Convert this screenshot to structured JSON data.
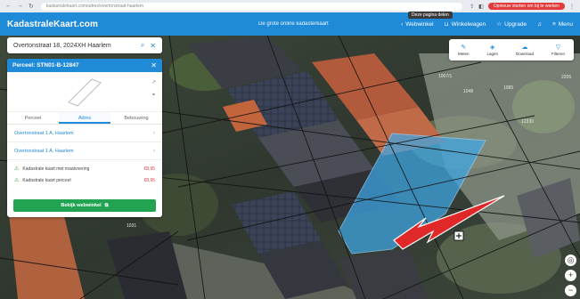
{
  "browser": {
    "url": "kadastralekaart.com/adres/overtonstraat-haarlem",
    "tooltip": "Deze pagina delen",
    "update": "Opnieuw starten om bij te werken"
  },
  "header": {
    "logo": "KadastraleKaart.com",
    "tagline": "De grote online kadasterkaart",
    "actions": [
      {
        "label": "Webwinkel",
        "icon": "cart-icon"
      },
      {
        "label": "Winkelwagen",
        "icon": "basket-icon"
      },
      {
        "label": "Upgrade",
        "icon": "star-icon"
      },
      {
        "label": "Menu",
        "icon": "menu-icon"
      }
    ]
  },
  "search": {
    "value": "Overtonstraat 18, 2024XH Haarlem"
  },
  "panel": {
    "title": "Perceel: STN01-B-12847",
    "tabs": [
      "Perceel",
      "Adres",
      "Bebouwing"
    ],
    "active_tab": 1,
    "addresses": [
      "Overtonstraat 1 A, Haarlem",
      "Overtonstraat 1 A, Haarlem"
    ],
    "products": [
      {
        "label": "Kadastrale kaart met maatvoering",
        "price": "€8,95"
      },
      {
        "label": "Kadastrale kaart perceel",
        "price": "€8,95"
      }
    ],
    "cta": "Bekijk webwinkel"
  },
  "tools": [
    {
      "label": "Meten",
      "icon": "ruler-icon"
    },
    {
      "label": "Lagen",
      "icon": "layers-icon"
    },
    {
      "label": "Download",
      "icon": "cloud-icon"
    },
    {
      "label": "Filteren",
      "icon": "filter-icon"
    }
  ],
  "map_labels": [
    "1007/1",
    "1048",
    "1085",
    "12330",
    "1031",
    "2205"
  ],
  "colors": {
    "brand": "#1f8ad8",
    "cta": "#22a352",
    "highlight": "#3ea8e8",
    "arrow": "#e02828"
  }
}
